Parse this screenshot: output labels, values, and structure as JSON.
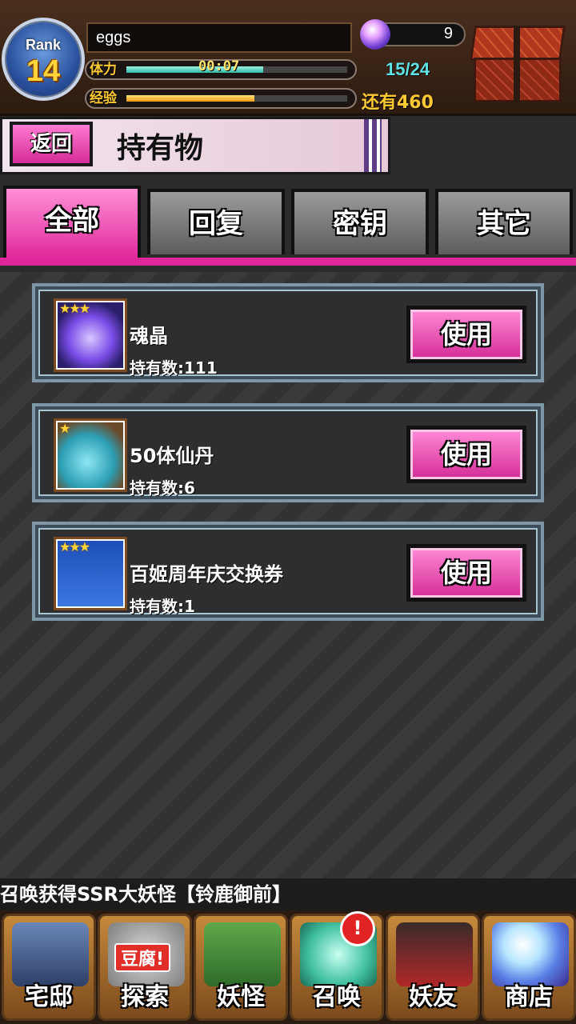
{
  "header": {
    "rank_label": "Rank",
    "rank_value": "14",
    "player_name": "eggs",
    "stamina_label": "体力",
    "stamina_timer": "00:07",
    "stamina_count": "15/24",
    "stamina_fill": 0.62,
    "exp_label": "经验",
    "exp_remaining": "还有460",
    "exp_fill": 0.58,
    "orb_count": "9"
  },
  "titlebar": {
    "back_label": "返回",
    "title": "持有物"
  },
  "tabs": [
    {
      "label": "全部",
      "active": true
    },
    {
      "label": "回复",
      "active": false
    },
    {
      "label": "密钥",
      "active": false
    },
    {
      "label": "其它",
      "active": false
    }
  ],
  "items": [
    {
      "name": "魂晶",
      "count_text": "持有数:111",
      "stars": "★★★",
      "use_label": "使用",
      "icon": "soul-crystal-icon"
    },
    {
      "name": "50体仙丹",
      "count_text": "持有数:6",
      "stars": "★",
      "use_label": "使用",
      "icon": "elixir-jar-icon"
    },
    {
      "name": "百姬周年庆交换券",
      "count_text": "持有数:1",
      "stars": "★★★",
      "use_label": "使用",
      "icon": "anniversary-ticket-icon"
    }
  ],
  "marquee": "召唤获得SSR大妖怪【铃鹿御前】",
  "nav": [
    {
      "label": "宅邸",
      "icon": "mansion-icon"
    },
    {
      "label": "探索",
      "icon": "explore-icon",
      "tag": "豆腐!"
    },
    {
      "label": "妖怪",
      "icon": "yokai-scroll-icon"
    },
    {
      "label": "召唤",
      "icon": "summon-star-icon",
      "badge": "!"
    },
    {
      "label": "妖友",
      "icon": "friend-icon"
    },
    {
      "label": "商店",
      "icon": "shop-orb-icon"
    }
  ],
  "colors": {
    "accent_pink": "#e0279a",
    "stamina_teal": "#2fb7a6",
    "exp_orange": "#f29b14",
    "gold": "#ffd43a"
  }
}
